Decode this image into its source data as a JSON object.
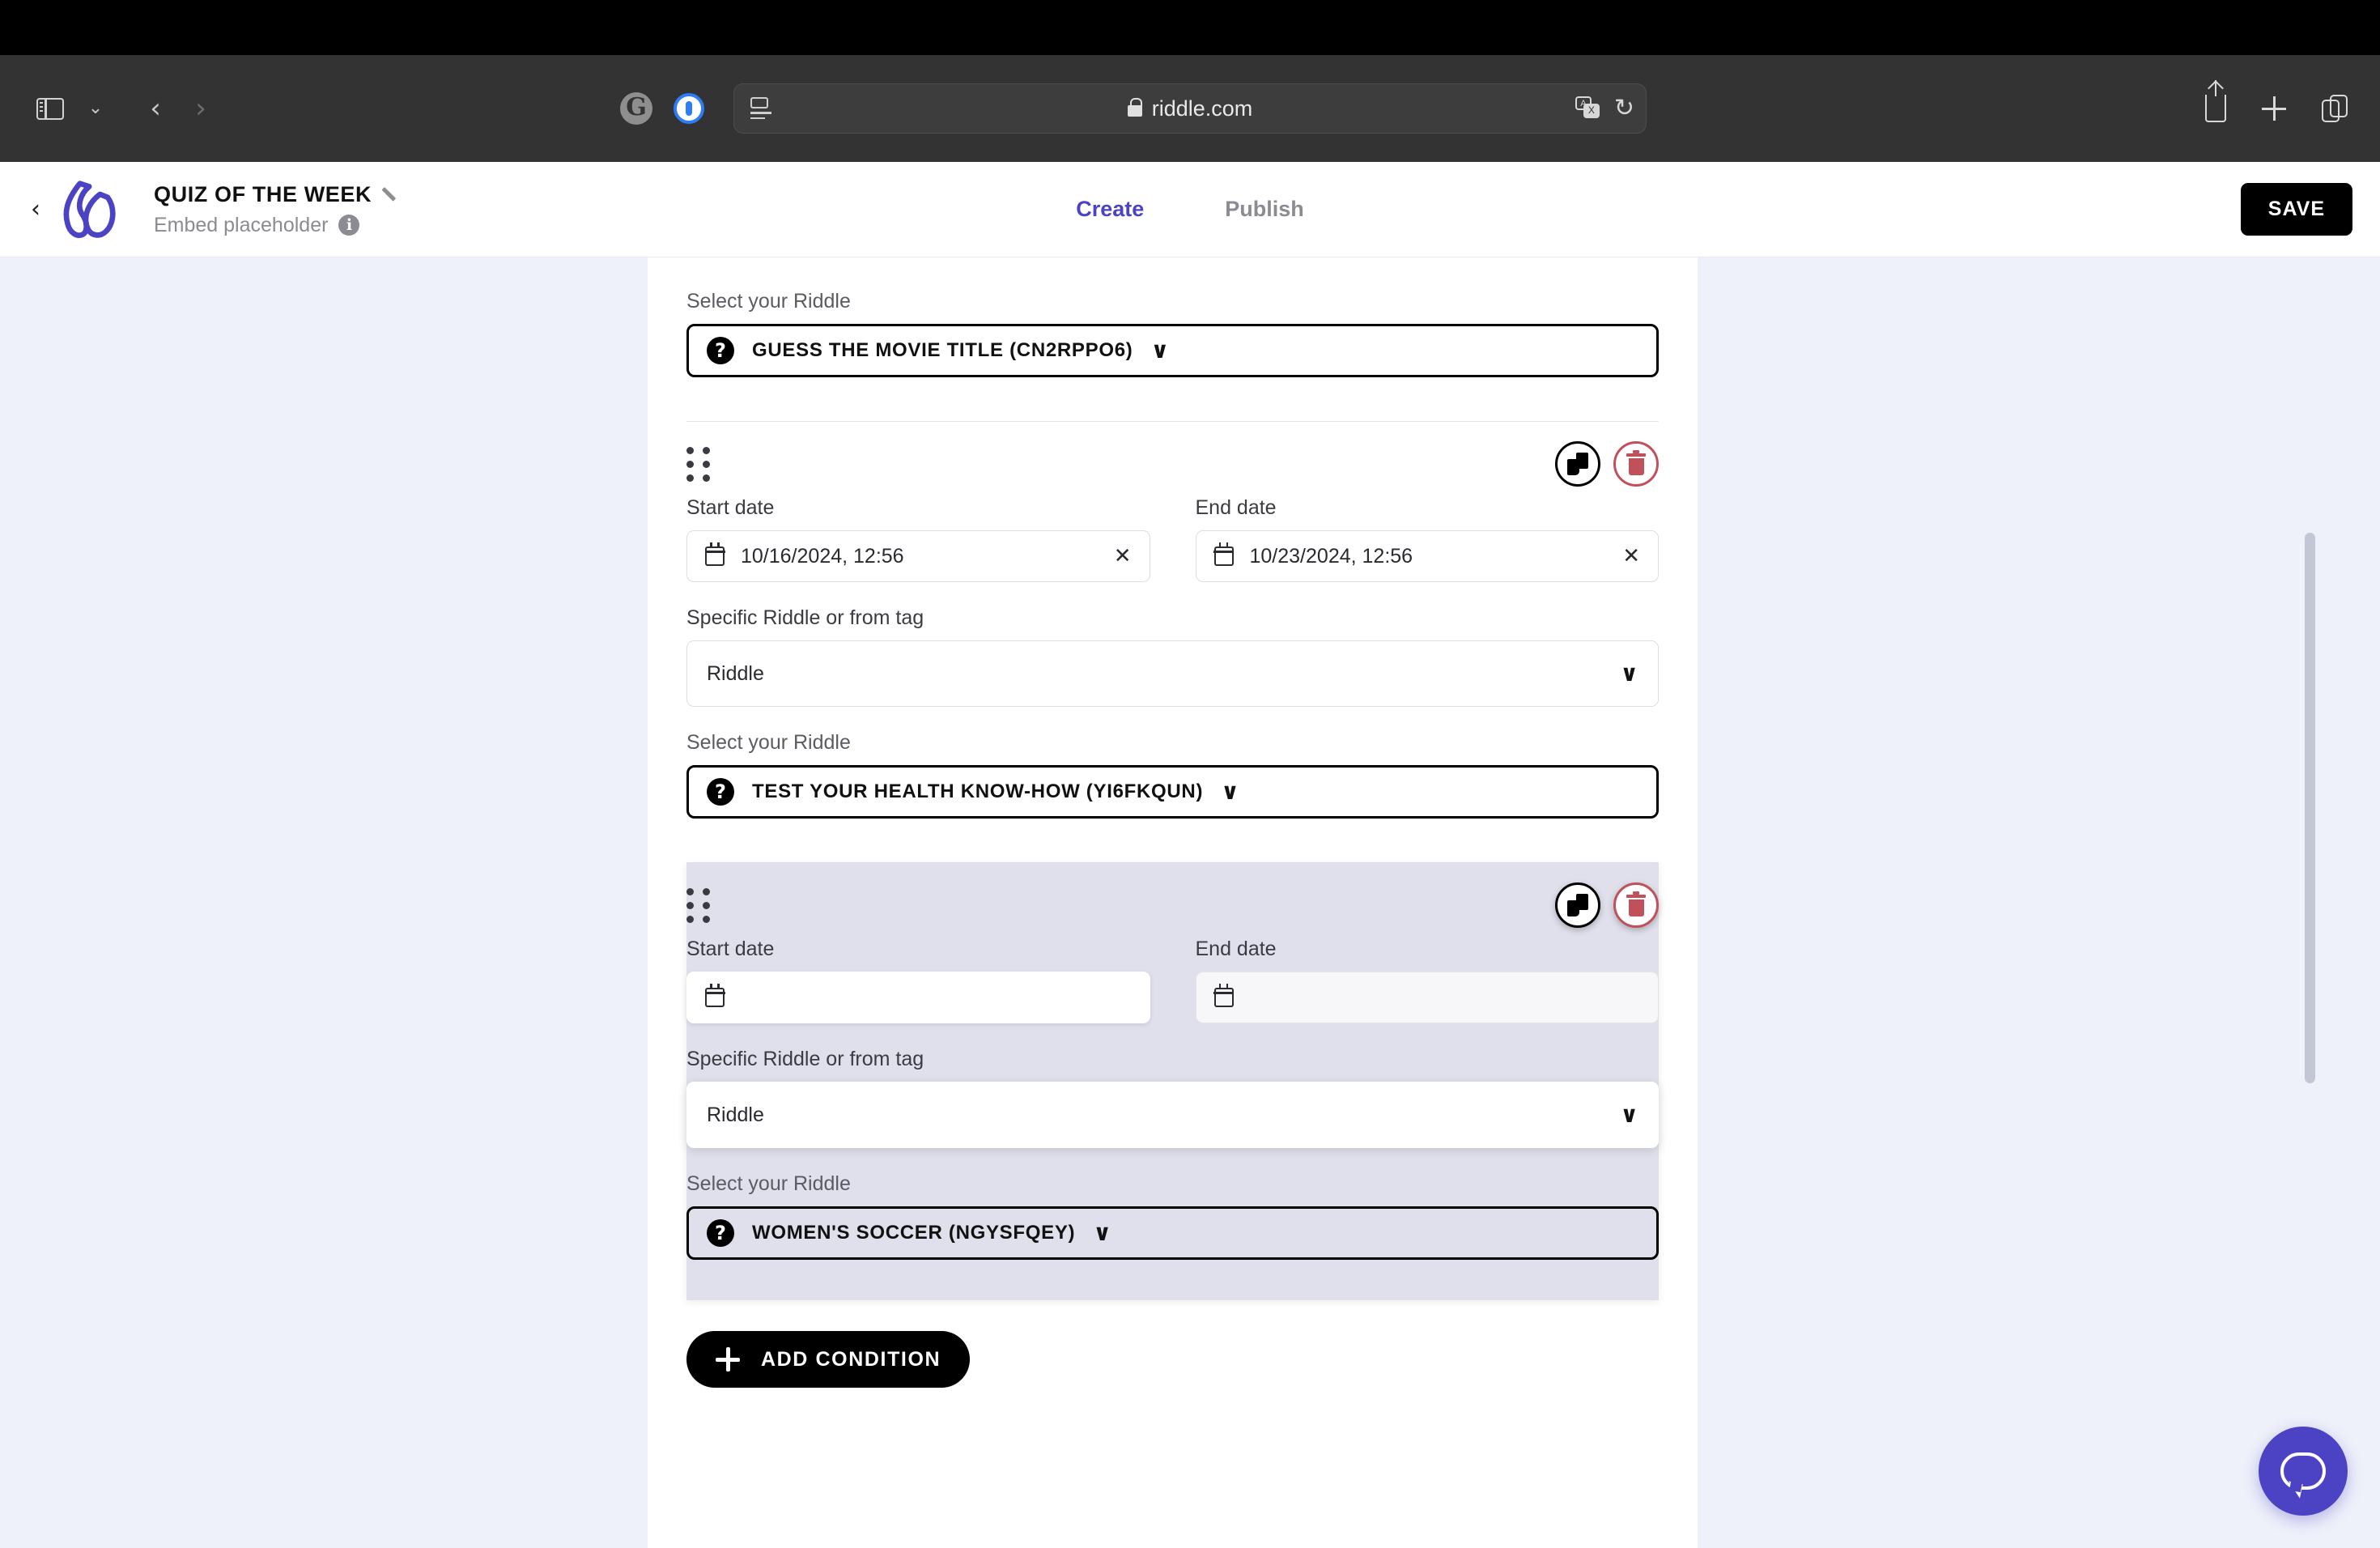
{
  "browser": {
    "url": "riddle.com",
    "icons": {
      "sidebar": "sidebar-icon",
      "sidebar_dropdown": "chevron-down-icon",
      "back": "back-chevron-icon",
      "forward": "forward-chevron-icon",
      "grammarly": "G",
      "onepassword": "1password-icon",
      "reader": "reader-view-icon",
      "lock": "lock-icon",
      "translate": "translate-icon",
      "reload": "↻",
      "share": "share-icon",
      "new_tab": "plus-icon",
      "tab_overview": "tab-overview-icon"
    }
  },
  "header": {
    "back_label": "‹",
    "logo_alt": "riddle-logo",
    "title": "QUIZ OF THE WEEK",
    "edit_icon": "pencil-icon",
    "subtitle": "Embed placeholder",
    "info_icon": "i",
    "tabs": [
      {
        "label": "Create",
        "active": true
      },
      {
        "label": "Publish",
        "active": false
      }
    ],
    "save_label": "SAVE"
  },
  "form": {
    "top_riddle": {
      "label": "Select your Riddle",
      "badge": "?",
      "value": "GUESS THE MOVIE TITLE (CN2RPPO6)",
      "caret": "∨"
    },
    "conditions": [
      {
        "drag_handle": "drag-handle-icon",
        "duplicate_icon": "duplicate-icon",
        "delete_icon": "trash-icon",
        "start_label": "Start date",
        "start_value": "10/16/2024, 12:56",
        "end_label": "End date",
        "end_value": "10/23/2024, 12:56",
        "clear_icon": "✕",
        "tag_label": "Specific Riddle or from tag",
        "tag_value": "Riddle",
        "tag_caret": "∨",
        "riddle_label": "Select your Riddle",
        "riddle_badge": "?",
        "riddle_value": "TEST YOUR HEALTH KNOW-HOW (YI6FKQUN)",
        "riddle_caret": "∨"
      },
      {
        "drag_handle": "drag-handle-icon",
        "duplicate_icon": "duplicate-icon",
        "delete_icon": "trash-icon",
        "start_label": "Start date",
        "start_value": "",
        "end_label": "End date",
        "end_value": "",
        "clear_icon": "",
        "tag_label": "Specific Riddle or from tag",
        "tag_value": "Riddle",
        "tag_caret": "∨",
        "riddle_label": "Select your Riddle",
        "riddle_badge": "?",
        "riddle_value": "WOMEN'S SOCCER (NGYSFQEY)",
        "riddle_caret": "∨"
      }
    ],
    "add_condition_label": "ADD CONDITION",
    "add_condition_icon": "plus-icon"
  },
  "widgets": {
    "chat_icon": "chat-bubble-icon"
  },
  "colors": {
    "accent": "#4b42c4",
    "page_bg": "#eef0fa",
    "danger": "#c0515b",
    "dragging_bg": "#dfe0ec"
  }
}
